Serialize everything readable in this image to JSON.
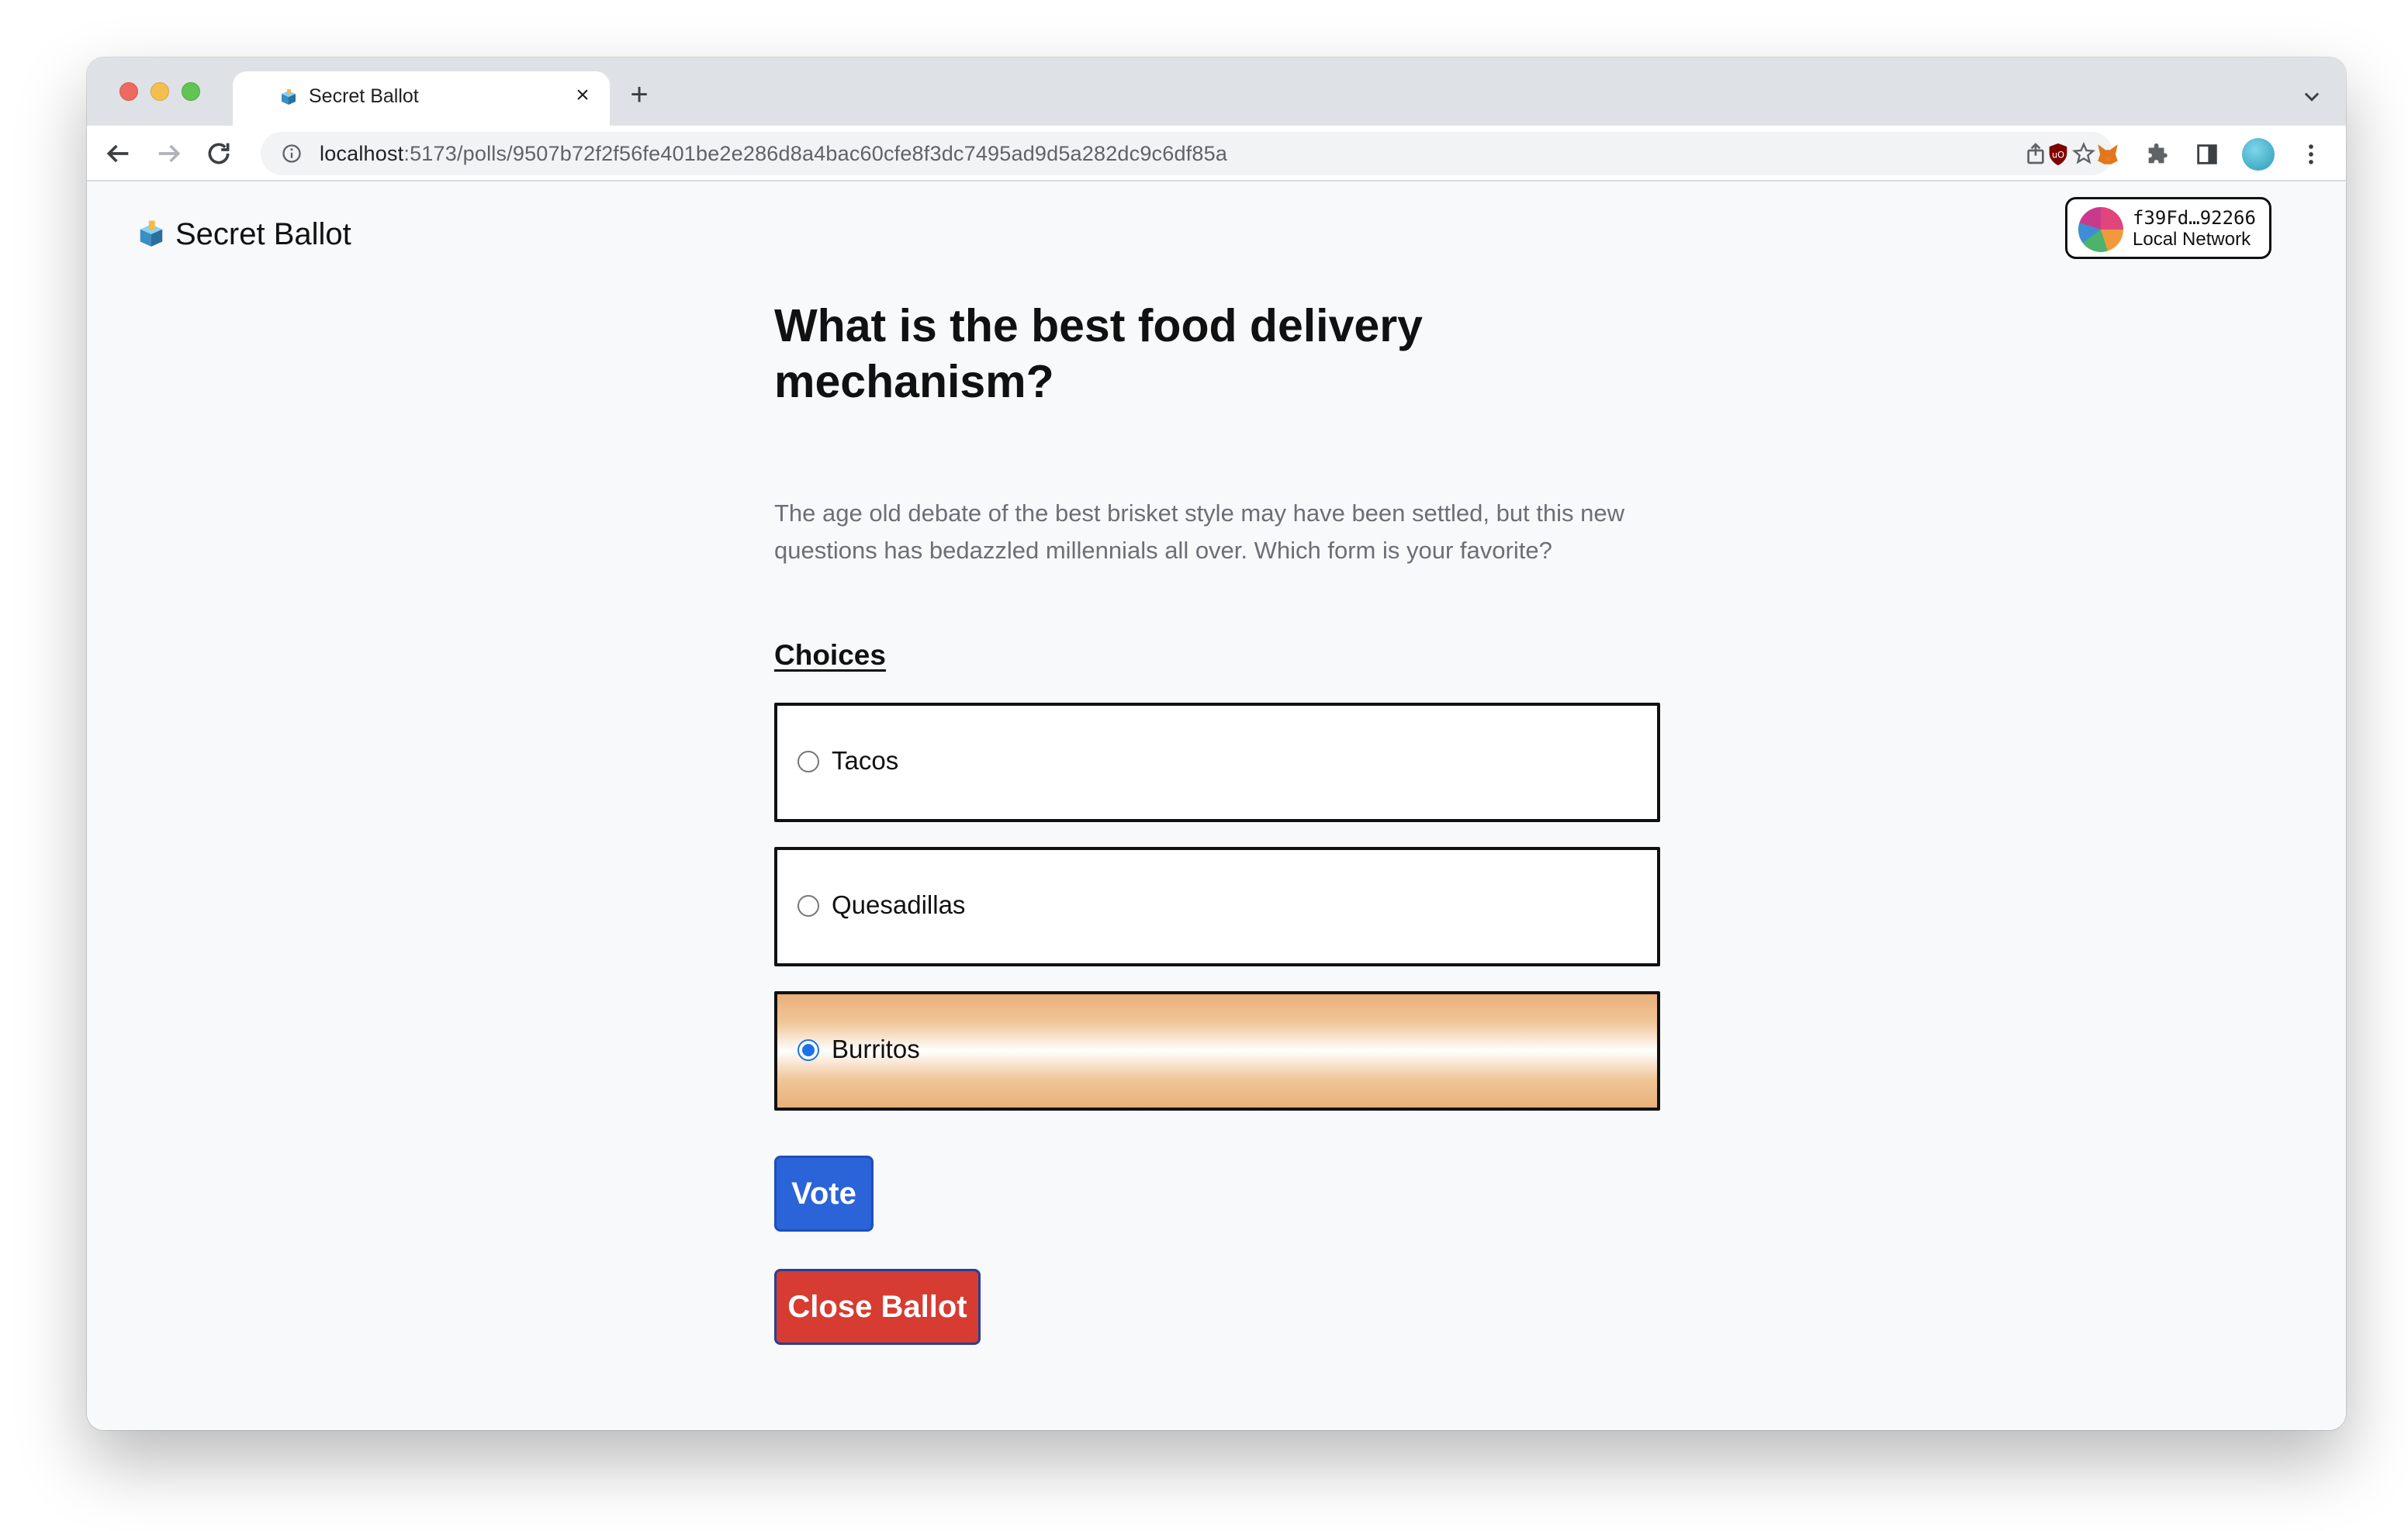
{
  "browser": {
    "tab_title": "Secret Ballot",
    "url_host": "localhost",
    "url_path": ":5173/polls/9507b72f2f56fe401be2e286d8a4bac60cfe8f3dc7495ad9d5a282dc9c6df85a"
  },
  "header": {
    "brand": "Secret Ballot",
    "account_address": "f39Fd…92266",
    "account_network": "Local Network"
  },
  "poll": {
    "question": "What is the best food delivery mechanism?",
    "description": "The age old debate of the best brisket style may have been settled, but this new questions has bedazzled millennials all over. Which form is your favorite?",
    "choices_heading": "Choices",
    "choices": [
      {
        "label": "Tacos",
        "selected": false
      },
      {
        "label": "Quesadillas",
        "selected": false
      },
      {
        "label": "Burritos",
        "selected": true
      }
    ],
    "vote_label": "Vote",
    "close_label": "Close Ballot"
  },
  "colors": {
    "vote_button": "#2b63d9",
    "close_button": "#d63c32",
    "selected_gradient": "#e9b07a"
  }
}
